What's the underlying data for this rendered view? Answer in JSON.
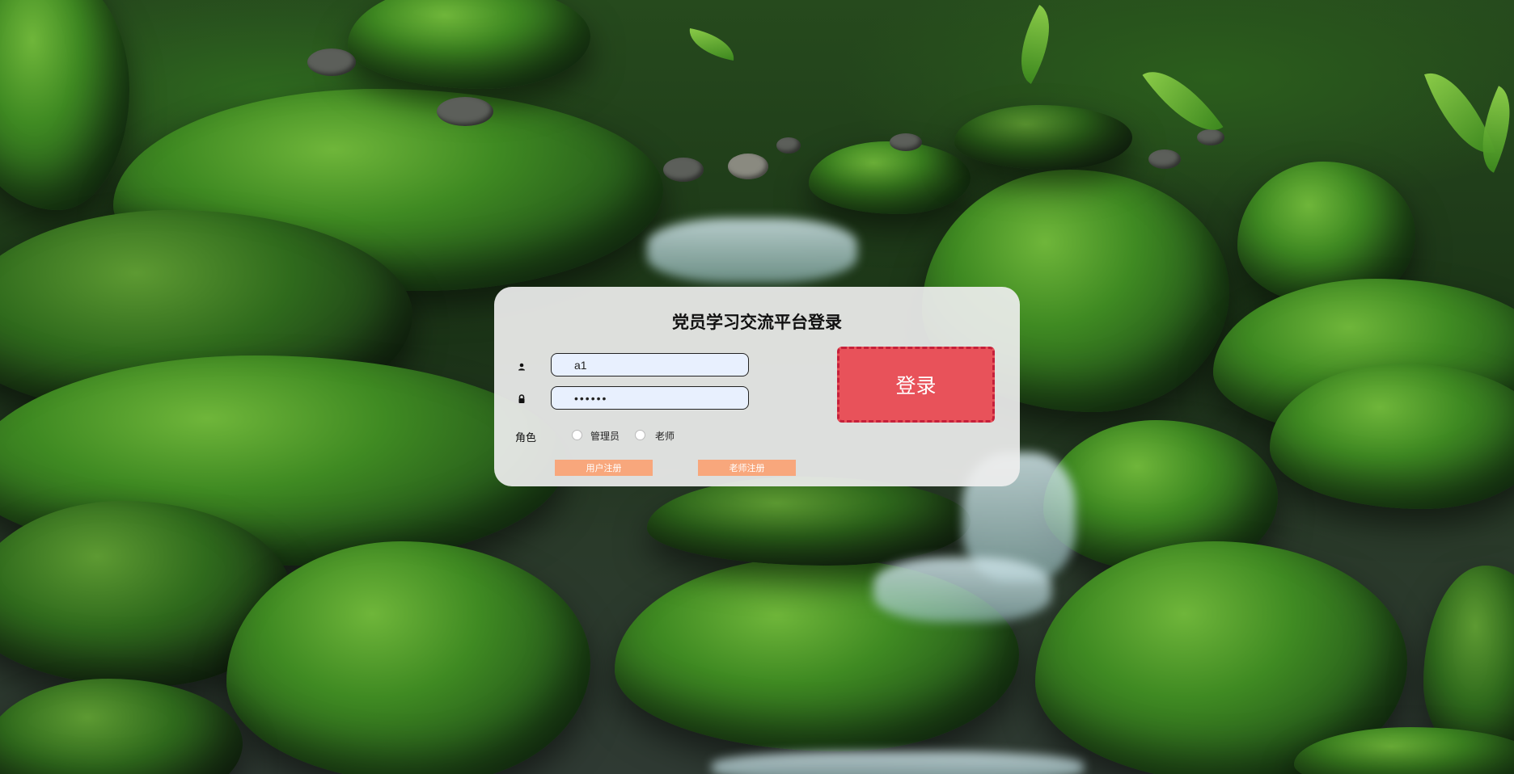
{
  "login": {
    "title": "党员学习交流平台登录",
    "username_value": "a1",
    "password_value": "••••••",
    "login_button": "登录",
    "role_label": "角色",
    "roles": [
      {
        "label": "管理员",
        "selected": false
      },
      {
        "label": "老师",
        "selected": false
      }
    ],
    "user_register": "用户注册",
    "teacher_register": "老师注册"
  },
  "colors": {
    "panel": "#eeeeee",
    "login_button": "#e8525a",
    "login_border": "#c5203a",
    "register_button": "#f8a77c",
    "input_bg": "#e8f0fe"
  },
  "icons": [
    "user-icon",
    "lock-icon"
  ]
}
